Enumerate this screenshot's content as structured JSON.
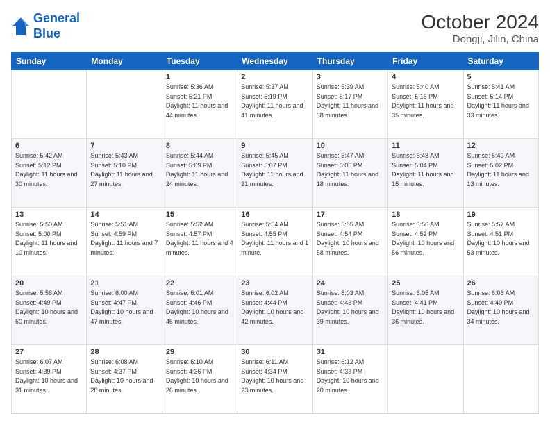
{
  "header": {
    "logo_line1": "General",
    "logo_line2": "Blue",
    "title": "October 2024",
    "subtitle": "Dongji, Jilin, China"
  },
  "weekdays": [
    "Sunday",
    "Monday",
    "Tuesday",
    "Wednesday",
    "Thursday",
    "Friday",
    "Saturday"
  ],
  "weeks": [
    [
      {
        "day": "",
        "info": ""
      },
      {
        "day": "",
        "info": ""
      },
      {
        "day": "1",
        "info": "Sunrise: 5:36 AM\nSunset: 5:21 PM\nDaylight: 11 hours and 44 minutes."
      },
      {
        "day": "2",
        "info": "Sunrise: 5:37 AM\nSunset: 5:19 PM\nDaylight: 11 hours and 41 minutes."
      },
      {
        "day": "3",
        "info": "Sunrise: 5:39 AM\nSunset: 5:17 PM\nDaylight: 11 hours and 38 minutes."
      },
      {
        "day": "4",
        "info": "Sunrise: 5:40 AM\nSunset: 5:16 PM\nDaylight: 11 hours and 35 minutes."
      },
      {
        "day": "5",
        "info": "Sunrise: 5:41 AM\nSunset: 5:14 PM\nDaylight: 11 hours and 33 minutes."
      }
    ],
    [
      {
        "day": "6",
        "info": "Sunrise: 5:42 AM\nSunset: 5:12 PM\nDaylight: 11 hours and 30 minutes."
      },
      {
        "day": "7",
        "info": "Sunrise: 5:43 AM\nSunset: 5:10 PM\nDaylight: 11 hours and 27 minutes."
      },
      {
        "day": "8",
        "info": "Sunrise: 5:44 AM\nSunset: 5:09 PM\nDaylight: 11 hours and 24 minutes."
      },
      {
        "day": "9",
        "info": "Sunrise: 5:45 AM\nSunset: 5:07 PM\nDaylight: 11 hours and 21 minutes."
      },
      {
        "day": "10",
        "info": "Sunrise: 5:47 AM\nSunset: 5:05 PM\nDaylight: 11 hours and 18 minutes."
      },
      {
        "day": "11",
        "info": "Sunrise: 5:48 AM\nSunset: 5:04 PM\nDaylight: 11 hours and 15 minutes."
      },
      {
        "day": "12",
        "info": "Sunrise: 5:49 AM\nSunset: 5:02 PM\nDaylight: 11 hours and 13 minutes."
      }
    ],
    [
      {
        "day": "13",
        "info": "Sunrise: 5:50 AM\nSunset: 5:00 PM\nDaylight: 11 hours and 10 minutes."
      },
      {
        "day": "14",
        "info": "Sunrise: 5:51 AM\nSunset: 4:59 PM\nDaylight: 11 hours and 7 minutes."
      },
      {
        "day": "15",
        "info": "Sunrise: 5:52 AM\nSunset: 4:57 PM\nDaylight: 11 hours and 4 minutes."
      },
      {
        "day": "16",
        "info": "Sunrise: 5:54 AM\nSunset: 4:55 PM\nDaylight: 11 hours and 1 minute."
      },
      {
        "day": "17",
        "info": "Sunrise: 5:55 AM\nSunset: 4:54 PM\nDaylight: 10 hours and 58 minutes."
      },
      {
        "day": "18",
        "info": "Sunrise: 5:56 AM\nSunset: 4:52 PM\nDaylight: 10 hours and 56 minutes."
      },
      {
        "day": "19",
        "info": "Sunrise: 5:57 AM\nSunset: 4:51 PM\nDaylight: 10 hours and 53 minutes."
      }
    ],
    [
      {
        "day": "20",
        "info": "Sunrise: 5:58 AM\nSunset: 4:49 PM\nDaylight: 10 hours and 50 minutes."
      },
      {
        "day": "21",
        "info": "Sunrise: 6:00 AM\nSunset: 4:47 PM\nDaylight: 10 hours and 47 minutes."
      },
      {
        "day": "22",
        "info": "Sunrise: 6:01 AM\nSunset: 4:46 PM\nDaylight: 10 hours and 45 minutes."
      },
      {
        "day": "23",
        "info": "Sunrise: 6:02 AM\nSunset: 4:44 PM\nDaylight: 10 hours and 42 minutes."
      },
      {
        "day": "24",
        "info": "Sunrise: 6:03 AM\nSunset: 4:43 PM\nDaylight: 10 hours and 39 minutes."
      },
      {
        "day": "25",
        "info": "Sunrise: 6:05 AM\nSunset: 4:41 PM\nDaylight: 10 hours and 36 minutes."
      },
      {
        "day": "26",
        "info": "Sunrise: 6:06 AM\nSunset: 4:40 PM\nDaylight: 10 hours and 34 minutes."
      }
    ],
    [
      {
        "day": "27",
        "info": "Sunrise: 6:07 AM\nSunset: 4:39 PM\nDaylight: 10 hours and 31 minutes."
      },
      {
        "day": "28",
        "info": "Sunrise: 6:08 AM\nSunset: 4:37 PM\nDaylight: 10 hours and 28 minutes."
      },
      {
        "day": "29",
        "info": "Sunrise: 6:10 AM\nSunset: 4:36 PM\nDaylight: 10 hours and 26 minutes."
      },
      {
        "day": "30",
        "info": "Sunrise: 6:11 AM\nSunset: 4:34 PM\nDaylight: 10 hours and 23 minutes."
      },
      {
        "day": "31",
        "info": "Sunrise: 6:12 AM\nSunset: 4:33 PM\nDaylight: 10 hours and 20 minutes."
      },
      {
        "day": "",
        "info": ""
      },
      {
        "day": "",
        "info": ""
      }
    ]
  ]
}
